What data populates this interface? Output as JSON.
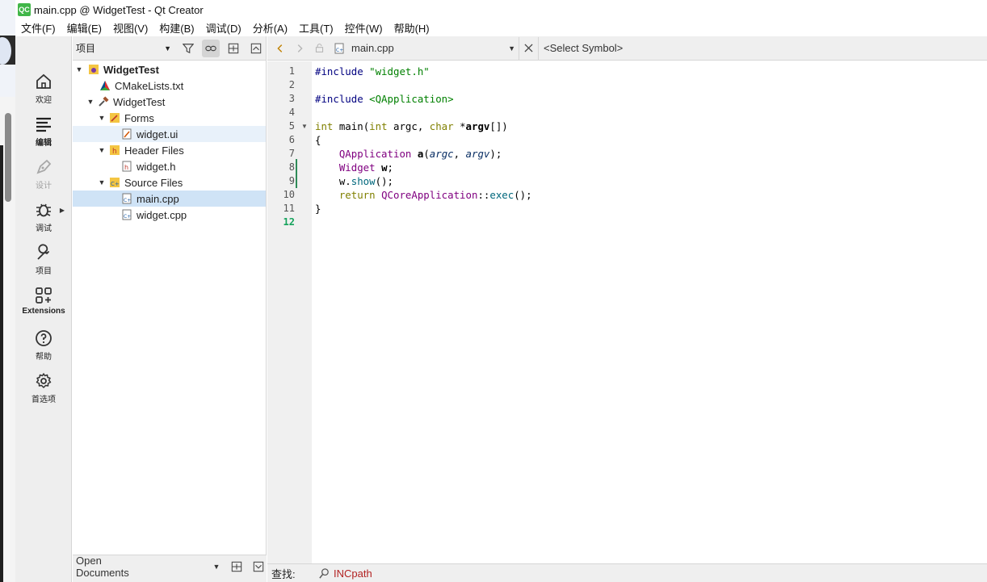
{
  "window": {
    "logo": "QC",
    "title": "main.cpp @ WidgetTest - Qt Creator"
  },
  "menubar": [
    "文件(F)",
    "编辑(E)",
    "视图(V)",
    "构建(B)",
    "调试(D)",
    "分析(A)",
    "工具(T)",
    "控件(W)",
    "帮助(H)"
  ],
  "modes": [
    {
      "label": "欢迎",
      "icon": "home-icon"
    },
    {
      "label": "编辑",
      "icon": "edit-lines-icon",
      "active": true
    },
    {
      "label": "设计",
      "icon": "pen-icon",
      "disabled": true
    },
    {
      "label": "调试",
      "icon": "bug-icon"
    },
    {
      "label": "项目",
      "icon": "wrench-icon"
    },
    {
      "label": "Extensions",
      "icon": "extensions-grid-icon"
    },
    {
      "label": "帮助",
      "icon": "help-icon"
    },
    {
      "label": "首选项",
      "icon": "gear-icon"
    }
  ],
  "project_panel": {
    "selector": "项目",
    "tree": [
      {
        "label": "WidgetTest",
        "depth": 0,
        "expanded": true,
        "icon": "project-icon",
        "bold": true
      },
      {
        "label": "CMakeLists.txt",
        "depth": 1,
        "icon": "cmake-icon"
      },
      {
        "label": "WidgetTest",
        "depth": 1,
        "expanded": true,
        "icon": "hammer-icon"
      },
      {
        "label": "Forms",
        "depth": 2,
        "expanded": true,
        "icon": "forms-folder-icon"
      },
      {
        "label": "widget.ui",
        "depth": 3,
        "icon": "ui-file-icon",
        "highlight": true
      },
      {
        "label": "Header Files",
        "depth": 2,
        "expanded": true,
        "icon": "header-folder-icon"
      },
      {
        "label": "widget.h",
        "depth": 3,
        "icon": "h-file-icon"
      },
      {
        "label": "Source Files",
        "depth": 2,
        "expanded": true,
        "icon": "source-folder-icon"
      },
      {
        "label": "main.cpp",
        "depth": 3,
        "icon": "cpp-file-icon",
        "selected": true
      },
      {
        "label": "widget.cpp",
        "depth": 3,
        "icon": "cpp-file-icon"
      }
    ],
    "open_documents": "Open Documents"
  },
  "editor": {
    "file": "main.cpp",
    "symbol": "<Select Symbol>",
    "line_numbers": [
      "1",
      "2",
      "3",
      "4",
      "5",
      "6",
      "7",
      "8",
      "9",
      "10",
      "11",
      "12"
    ],
    "current_line": "12",
    "code": {
      "l1_pp": "#include ",
      "l1_str": "\"widget.h\"",
      "l3_pp": "#include ",
      "l3_str": "<QApplication>",
      "l5_kw1": "int",
      "l5_fn": " main(",
      "l5_kw2": "int",
      "l5_argc": " argc, ",
      "l5_kw3": "char",
      "l5_star": " *",
      "l5_argv": "argv",
      "l5_end": "[])",
      "l6": "{",
      "l7_ty": "QApplication",
      "l7_sp": " ",
      "l7_a": "a",
      "l7_open": "(",
      "l7_p1": "argc",
      "l7_comma": ", ",
      "l7_p2": "argv",
      "l7_close": ");",
      "l8_ty": "Widget",
      "l8_sp": " ",
      "l8_w": "w",
      "l8_end": ";",
      "l9_w": "w.",
      "l9_fn": "show",
      "l9_end": "();",
      "l10_kw": "return",
      "l10_sp": " ",
      "l10_ty": "QCoreApplication",
      "l10_sep": "::",
      "l10_fn": "exec",
      "l10_end": "();",
      "l11": "}"
    }
  },
  "findbar": {
    "label": "查找:",
    "value": "INCpath"
  }
}
